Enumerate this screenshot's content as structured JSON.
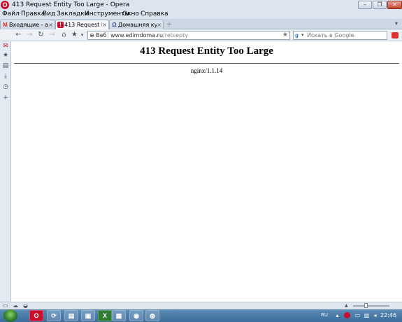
{
  "window": {
    "title": "413 Request Entity Too Large - Opera",
    "min_label": "–",
    "max_label": "❐",
    "close_label": "✕"
  },
  "menu": {
    "items": [
      "Файл",
      "Правка",
      "Вид",
      "Закладки",
      "Инструменты",
      "Окно",
      "Справка"
    ]
  },
  "tabs": [
    {
      "label": "Входящие - al...",
      "icon": "gmail-icon",
      "active": false
    },
    {
      "label": "413 Request En...",
      "icon": "opera-page-icon",
      "active": true
    },
    {
      "label": "Домашняя кух...",
      "icon": "chef-icon",
      "active": false
    }
  ],
  "address": {
    "web_badge": "Веб",
    "url_host": "www.edimdoma.ru",
    "url_path": "/retsepty"
  },
  "search": {
    "placeholder": "Искать в Google"
  },
  "page": {
    "heading": "413 Request Entity Too Large",
    "footer": "nginx/1.1.14"
  },
  "taskbar": {
    "lang": "RU",
    "clock": "22:46"
  }
}
